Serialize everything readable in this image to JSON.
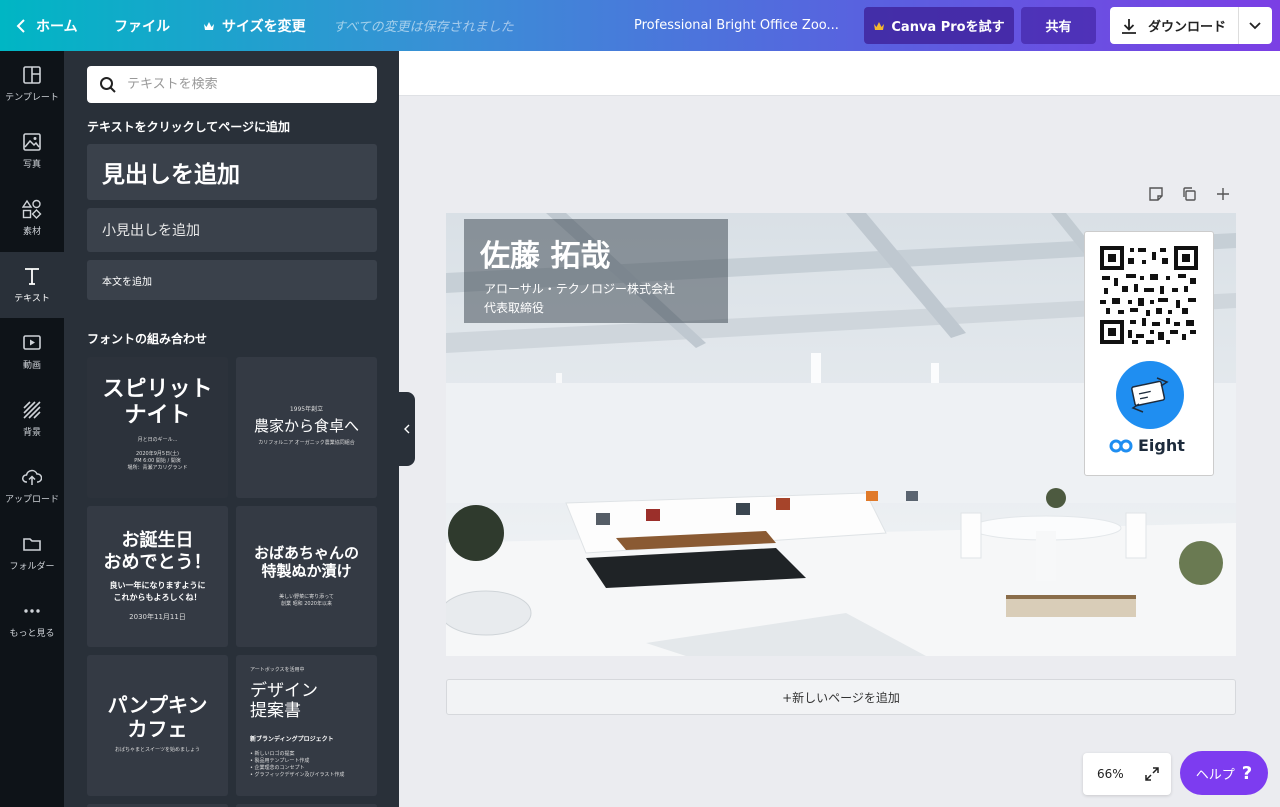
{
  "header": {
    "home_label": "ホーム",
    "file_label": "ファイル",
    "resize_label": "サイズを変更",
    "saved_status": "すべての変更は保存されました",
    "doc_title": "Professional Bright Office Zoo...",
    "pro_label": "Canva Proを試す",
    "share_label": "共有",
    "download_label": "ダウンロード"
  },
  "sidebar": {
    "items": [
      {
        "label": "テンプレート",
        "icon": "template-icon"
      },
      {
        "label": "写真",
        "icon": "photo-icon"
      },
      {
        "label": "素材",
        "icon": "elements-icon"
      },
      {
        "label": "テキスト",
        "icon": "text-icon"
      },
      {
        "label": "動画",
        "icon": "video-icon"
      },
      {
        "label": "背景",
        "icon": "background-icon"
      },
      {
        "label": "アップロード",
        "icon": "upload-icon"
      },
      {
        "label": "フォルダー",
        "icon": "folder-icon"
      },
      {
        "label": "もっと見る",
        "icon": "more-icon"
      }
    ]
  },
  "panel": {
    "search_placeholder": "テキストを検索",
    "click_to_add": "テキストをクリックしてページに追加",
    "add_heading": "見出しを追加",
    "add_subheading": "小見出しを追加",
    "add_body": "本文を追加",
    "font_combos_label": "フォントの組み合わせ",
    "combos": [
      {
        "title": "スピリット\nナイト",
        "lines": [
          "月と日のギール...",
          "2020年9月5日(土)",
          "PM 6:00 開始 / 開演",
          "場所：青瀬アカリグランド"
        ]
      },
      {
        "title": "農家から食卓へ",
        "pre": "1995年創立",
        "lines": [
          "カリフォルニア オーガニック農業協同組合"
        ]
      },
      {
        "title": "お誕生日\nおめでとう！",
        "sub": "良い一年になりますように\nこれからもよろしくね！",
        "lines": [
          "2030年11月11日"
        ]
      },
      {
        "title": "おばあちゃんの\n特製ぬか漬け",
        "lines": [
          "美しい野菜に寄り添って",
          "創業 昭和 2020年以来"
        ]
      },
      {
        "title": "パンプキン\nカフェ",
        "lines": [
          "おばちゃまとスイーツを始めましょう"
        ]
      },
      {
        "title": "デザイン\n提案書",
        "pre": "アートボックスを活用中",
        "sub": "新ブランディングプロジェクト",
        "lines": [
          "• 新しいロゴの提案",
          "• 製品用テンプレート作成",
          "• 企業理念のコンセプト",
          "• グラフィックデザイン及びイラスト作成"
        ]
      }
    ]
  },
  "card": {
    "name": "佐藤 拓哉",
    "company": "アローサル・テクノロジー株式会社",
    "title": "代表取締役",
    "brand": "Eight"
  },
  "canvas": {
    "add_page_label": "+新しいページを追加",
    "zoom": "66%",
    "help_label": "ヘルプ",
    "help_glyph": "?"
  },
  "colors": {
    "accent": "#7d3cf0",
    "panel_bg": "#293039",
    "nav_bg": "#0e1318",
    "eight_blue": "#1f8ef1"
  }
}
